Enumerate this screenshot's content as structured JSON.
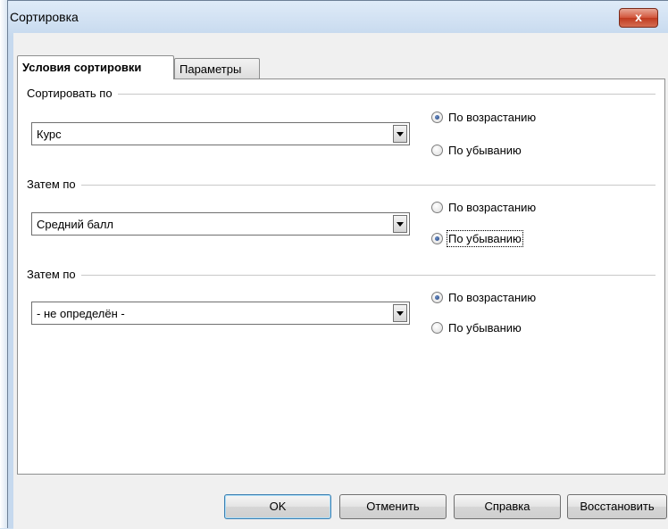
{
  "window": {
    "title": "Сортировка",
    "close_glyph": "x"
  },
  "tabs": [
    {
      "label": "Условия сортировки",
      "active": true
    },
    {
      "label": "Параметры",
      "active": false
    }
  ],
  "groups": [
    {
      "label": "Сортировать по",
      "selected": "Курс",
      "ascending": "По возрастанию",
      "descending": "По убыванию",
      "order": "ascending"
    },
    {
      "label": "Затем по",
      "selected": "Средний балл",
      "ascending": "По возрастанию",
      "descending": "По убыванию",
      "order": "descending"
    },
    {
      "label": "Затем по",
      "selected": "- не определён -",
      "ascending": "По возрастанию",
      "descending": "По убыванию",
      "order": "ascending"
    }
  ],
  "buttons": {
    "ok": "OK",
    "cancel": "Отменить",
    "help": "Справка",
    "reset": "Восстановить"
  },
  "colors": {
    "close_button": "#c8452a",
    "title_bar": "#c6d9ee"
  }
}
